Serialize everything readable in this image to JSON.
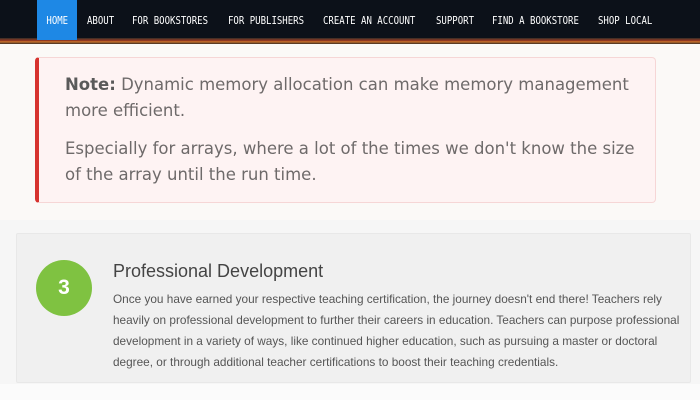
{
  "nav": {
    "items": [
      {
        "label": "HOME",
        "active": true
      },
      {
        "label": "ABOUT",
        "active": false
      },
      {
        "label": "FOR BOOKSTORES",
        "active": false
      },
      {
        "label": "FOR PUBLISHERS",
        "active": false
      },
      {
        "label": "CREATE AN ACCOUNT",
        "active": false
      },
      {
        "label": "SUPPORT",
        "active": false
      },
      {
        "label": "FIND A BOOKSTORE",
        "active": false
      },
      {
        "label": "SHOP LOCAL",
        "active": false
      }
    ],
    "active_color": "#1e88e5"
  },
  "note": {
    "label": "Note:",
    "text1": " Dynamic memory allocation can make memory management more efficient.",
    "text2": "Especially for arrays, where a lot of the times we don't know the size of the array until the run time.",
    "accent_color": "#d6332f"
  },
  "step": {
    "number": "3",
    "title": "Professional Development",
    "body": "Once you have earned your respective teaching certification, the journey doesn't end there! Teachers rely heavily on professional development to further their careers in education. Teachers can purpose professional development in a variety of ways, like continued higher education, such as pursuing a master or doctoral degree, or through additional teacher certifications to boost their teaching credentials.",
    "circle_color": "#7fc241"
  }
}
